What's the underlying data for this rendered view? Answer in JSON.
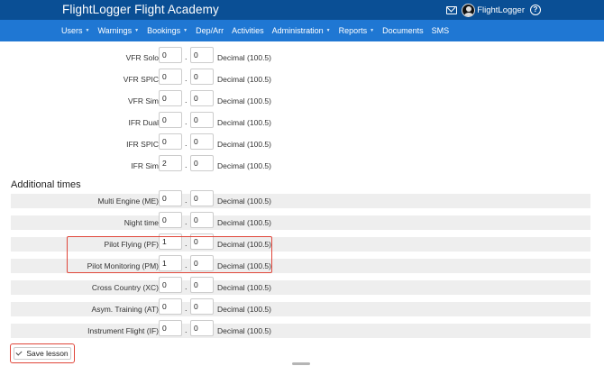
{
  "header": {
    "brand": "FlightLogger Flight Academy",
    "user": "FlightLogger",
    "icons": [
      "mail-icon",
      "avatar",
      "help-icon"
    ]
  },
  "nav": [
    {
      "label": "Users",
      "dropdown": true
    },
    {
      "label": "Warnings",
      "dropdown": true
    },
    {
      "label": "Bookings",
      "dropdown": true
    },
    {
      "label": "Dep/Arr",
      "dropdown": false
    },
    {
      "label": "Activities",
      "dropdown": false
    },
    {
      "label": "Administration",
      "dropdown": true
    },
    {
      "label": "Reports",
      "dropdown": true
    },
    {
      "label": "Documents",
      "dropdown": false
    },
    {
      "label": "SMS",
      "dropdown": false
    }
  ],
  "time_rows": [
    {
      "label": "VFR Solo",
      "hours": "0",
      "minutes": "0",
      "hint": "Decimal (100.5)"
    },
    {
      "label": "VFR SPIC",
      "hours": "0",
      "minutes": "0",
      "hint": "Decimal (100.5)"
    },
    {
      "label": "VFR Sim",
      "hours": "0",
      "minutes": "0",
      "hint": "Decimal (100.5)"
    },
    {
      "label": "IFR Dual",
      "hours": "0",
      "minutes": "0",
      "hint": "Decimal (100.5)"
    },
    {
      "label": "IFR SPIC",
      "hours": "0",
      "minutes": "0",
      "hint": "Decimal (100.5)"
    },
    {
      "label": "IFR Sim",
      "hours": "2",
      "minutes": "0",
      "hint": "Decimal (100.5)"
    }
  ],
  "additional_heading": "Additional times",
  "additional_rows": [
    {
      "label": "Multi Engine (ME)",
      "hours": "0",
      "minutes": "0",
      "hint": "Decimal (100.5)"
    },
    {
      "label": "Night time",
      "hours": "0",
      "minutes": "0",
      "hint": "Decimal (100.5)"
    },
    {
      "label": "Pilot Flying (PF)",
      "hours": "1",
      "minutes": "0",
      "hint": "Decimal (100.5)"
    },
    {
      "label": "Pilot Monitoring (PM)",
      "hours": "1",
      "minutes": "0",
      "hint": "Decimal (100.5)"
    },
    {
      "label": "Cross Country (XC)",
      "hours": "0",
      "minutes": "0",
      "hint": "Decimal (100.5)"
    },
    {
      "label": "Asym. Training (AT)",
      "hours": "0",
      "minutes": "0",
      "hint": "Decimal (100.5)"
    },
    {
      "label": "Instrument Flight (IF)",
      "hours": "0",
      "minutes": "0",
      "hint": "Decimal (100.5)"
    }
  ],
  "save_label": "Save lesson",
  "colors": {
    "header": "#0a4f95",
    "navbar": "#1f77d3",
    "highlight": "#e0463a",
    "row_shade": "#eeeeee"
  }
}
